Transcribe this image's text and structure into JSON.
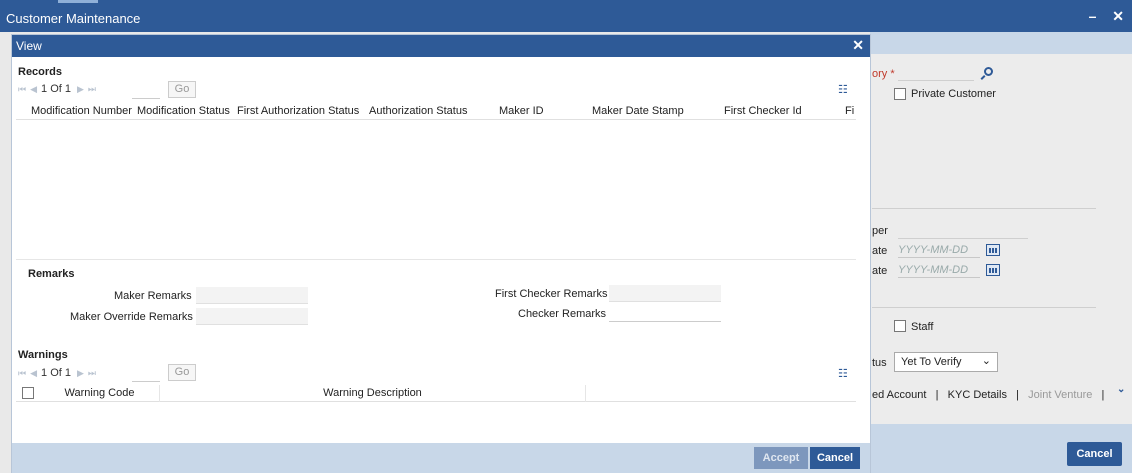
{
  "window": {
    "title": "Customer Maintenance",
    "minimize_label": "–",
    "close_label": "✕"
  },
  "background": {
    "category_label": "ory",
    "required_mark": "*",
    "private_customer_label": "Private Customer",
    "number_label": "per",
    "date1_label": "ate",
    "date2_label": "ate",
    "date_placeholder": "YYYY-MM-DD",
    "staff_label": "Staff",
    "status_label": "tus",
    "status_value": "Yet To Verify",
    "links": {
      "linked_account": "ed Account",
      "sep1": "|",
      "kyc": "KYC Details",
      "sep2": "|",
      "joint": "Joint Venture",
      "sep3": "|"
    },
    "cancel_label": "Cancel"
  },
  "dialog": {
    "title": "View",
    "close_label": "✕",
    "records": {
      "title": "Records",
      "pager_text": "1 Of 1",
      "go_label": "Go",
      "columns": [
        "Modification Number",
        "Modification Status",
        "First Authorization Status",
        "Authorization Status",
        "Maker ID",
        "Maker Date Stamp",
        "First Checker Id",
        "Fi"
      ]
    },
    "remarks": {
      "title": "Remarks",
      "maker_remarks": "Maker Remarks",
      "maker_override_remarks": "Maker Override Remarks",
      "first_checker_remarks": "First Checker Remarks",
      "checker_remarks": "Checker Remarks"
    },
    "warnings": {
      "title": "Warnings",
      "pager_text": "1 Of 1",
      "go_label": "Go",
      "col_code": "Warning Code",
      "col_description": "Warning Description"
    },
    "accept_label": "Accept",
    "cancel_label": "Cancel"
  },
  "colors": {
    "primary": "#2e5a97",
    "footer": "#c8d7e8",
    "required": "#c0392b"
  }
}
